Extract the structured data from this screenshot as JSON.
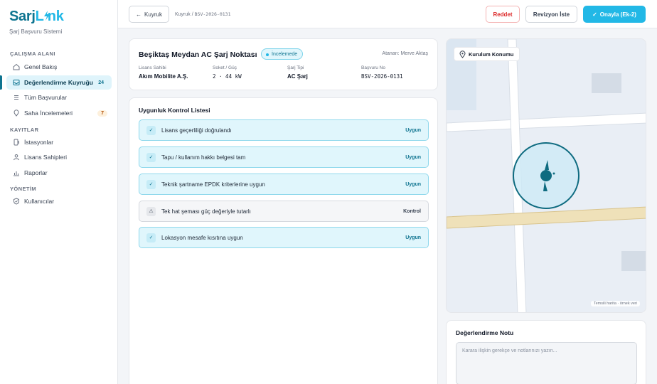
{
  "brand": {
    "name_a": "Sarj",
    "name_b": "L",
    "name_accent": "i",
    "name_c": "nk",
    "subtitle": "Şarj Başvuru Sistemi"
  },
  "sidebar": {
    "sections": [
      {
        "label": "ÇALIŞMA ALANI"
      },
      {
        "label": "KAYITLAR"
      },
      {
        "label": "YÖNETİM"
      }
    ],
    "items": [
      {
        "label": "Genel Bakış",
        "icon": "home-icon"
      },
      {
        "label": "Değerlendirme Kuyruğu",
        "icon": "inbox-icon",
        "count": "24",
        "active": true
      },
      {
        "label": "Tüm Başvurular",
        "icon": "list-icon"
      },
      {
        "label": "Saha İncelemeleri",
        "icon": "map-pin-icon",
        "count": "7"
      },
      {
        "label": "İstasyonlar",
        "icon": "charger-icon"
      },
      {
        "label": "Lisans Sahipleri",
        "icon": "user-icon"
      },
      {
        "label": "Raporlar",
        "icon": "bar-chart-icon"
      },
      {
        "label": "Kullanıcılar",
        "icon": "shield-icon"
      }
    ]
  },
  "topbar": {
    "back_label": "Kuyruk",
    "breadcrumb_prefix": "Kuyruk / ",
    "breadcrumb_id": "BSV-2026-0131",
    "reject_label": "Reddet",
    "revise_label": "Revizyon İste",
    "approve_label": "Onayla (Ek-2)"
  },
  "application": {
    "title": "Beşiktaş Meydan AC Şarj Noktası",
    "status": "İncelemede",
    "assigned": "Atanan: Merve Aktaş",
    "fields": [
      {
        "key": "Lisans Sahibi",
        "value": "Akım Mobilite A.Ş."
      },
      {
        "key": "Soket / Güç",
        "value": "2 · 44 kW"
      },
      {
        "key": "Şarj Tipi",
        "value": "AC Şarj"
      },
      {
        "key": "Başvuru No",
        "value": "BSV-2026-0131"
      }
    ]
  },
  "checklist": {
    "title": "Uygunluk Kontrol Listesi",
    "items": [
      {
        "label": "Lisans geçerliliği doğrulandı",
        "status": "Uygun"
      },
      {
        "label": "Tapu / kullanım hakkı belgesi tam",
        "status": "Uygun"
      },
      {
        "label": "Teknik şartname EPDK kriterlerine uygun",
        "status": "Uygun"
      },
      {
        "label": "Tek hat şeması güç değeriyle tutarlı",
        "status": "Kontrol"
      },
      {
        "label": "Lokasyon mesafe kısıtına uygun",
        "status": "Uygun"
      }
    ]
  },
  "map": {
    "label": "Kurulum Konumu",
    "footnote": "Temsili harita · örnek veri"
  },
  "note": {
    "title": "Değerlendirme Notu",
    "placeholder": "Karara ilişkin gerekçe ve notlarınızı yazın..."
  },
  "colors": {
    "accent": "#22b8e6",
    "brand": "#0e7490",
    "danger": "#dc2626"
  }
}
